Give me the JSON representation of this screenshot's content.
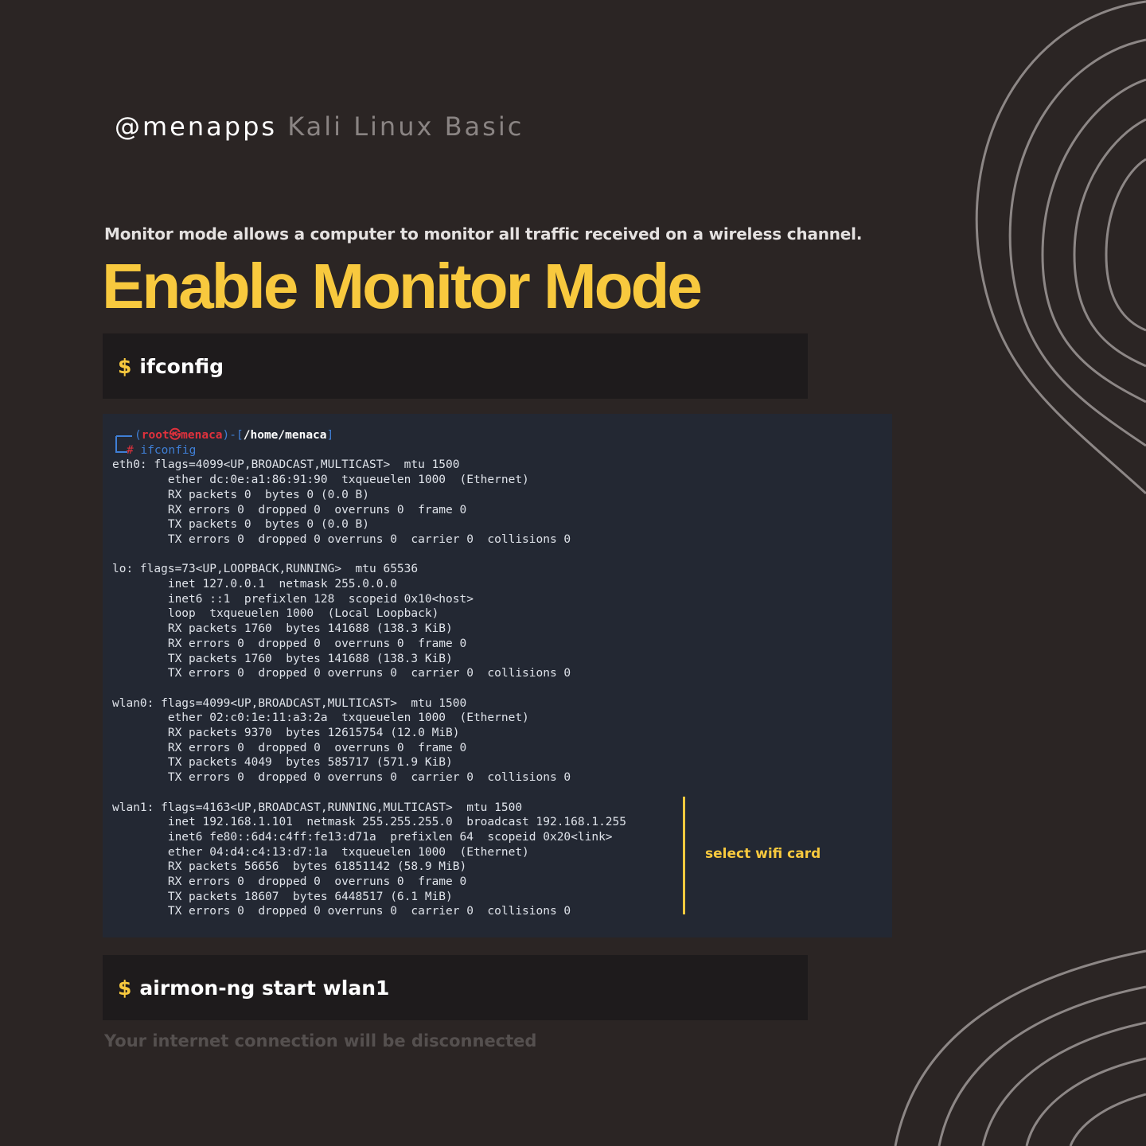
{
  "brand": {
    "handle": "@menapps",
    "series": "Kali Linux Basic"
  },
  "intro": "Monitor mode allows a computer  to monitor all traffic received on a wireless channel.",
  "title": "Enable Monitor Mode",
  "commands": [
    {
      "prompt": "$",
      "text": "ifconfig"
    },
    {
      "prompt": "$",
      "text": "airmon-ng start wlan1"
    }
  ],
  "terminal": {
    "prompt": {
      "user": "root",
      "at_symbol": "㉿",
      "host": "menaca",
      "path": "/home/menaca",
      "hash": "#",
      "command": "ifconfig"
    },
    "output": [
      "eth0: flags=4099<UP,BROADCAST,MULTICAST>  mtu 1500",
      "        ether dc:0e:a1:86:91:90  txqueuelen 1000  (Ethernet)",
      "        RX packets 0  bytes 0 (0.0 B)",
      "        RX errors 0  dropped 0  overruns 0  frame 0",
      "        TX packets 0  bytes 0 (0.0 B)",
      "        TX errors 0  dropped 0 overruns 0  carrier 0  collisions 0",
      "",
      "lo: flags=73<UP,LOOPBACK,RUNNING>  mtu 65536",
      "        inet 127.0.0.1  netmask 255.0.0.0",
      "        inet6 ::1  prefixlen 128  scopeid 0x10<host>",
      "        loop  txqueuelen 1000  (Local Loopback)",
      "        RX packets 1760  bytes 141688 (138.3 KiB)",
      "        RX errors 0  dropped 0  overruns 0  frame 0",
      "        TX packets 1760  bytes 141688 (138.3 KiB)",
      "        TX errors 0  dropped 0 overruns 0  carrier 0  collisions 0",
      "",
      "wlan0: flags=4099<UP,BROADCAST,MULTICAST>  mtu 1500",
      "        ether 02:c0:1e:11:a3:2a  txqueuelen 1000  (Ethernet)",
      "        RX packets 9370  bytes 12615754 (12.0 MiB)",
      "        RX errors 0  dropped 0  overruns 0  frame 0",
      "        TX packets 4049  bytes 585717 (571.9 KiB)",
      "        TX errors 0  dropped 0 overruns 0  carrier 0  collisions 0",
      "",
      "wlan1: flags=4163<UP,BROADCAST,RUNNING,MULTICAST>  mtu 1500",
      "        inet 192.168.1.101  netmask 255.255.255.0  broadcast 192.168.1.255",
      "        inet6 fe80::6d4:c4ff:fe13:d71a  prefixlen 64  scopeid 0x20<link>",
      "        ether 04:d4:c4:13:d7:1a  txqueuelen 1000  (Ethernet)",
      "        RX packets 56656  bytes 61851142 (58.9 MiB)",
      "        RX errors 0  dropped 0  overruns 0  frame 0",
      "        TX packets 18607  bytes 6448517 (6.1 MiB)",
      "        TX errors 0  dropped 0 overruns 0  carrier 0  collisions 0"
    ]
  },
  "annotation": "select wifi card",
  "footnote": "Your internet connection will be disconnected",
  "colors": {
    "background": "#2b2524",
    "accent": "#f8c93e",
    "command_bar": "#1e1b1c",
    "terminal_bg": "#232833"
  }
}
